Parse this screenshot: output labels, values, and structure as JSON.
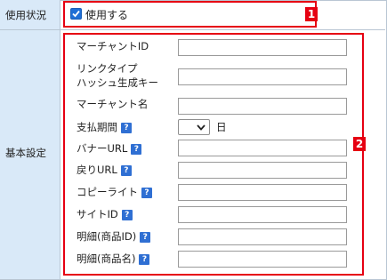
{
  "usage": {
    "label": "使用状況",
    "checkbox_label": "使用する",
    "checked": true,
    "badge": "1"
  },
  "basic": {
    "label": "基本設定",
    "badge": "2",
    "fields": {
      "merchant_id": "マーチャントID",
      "link_type_line1": "リンクタイプ",
      "link_type_line2": "ハッシュ生成キー",
      "merchant_name": "マーチャント名",
      "payment_period": "支払期間",
      "payment_period_unit": "日",
      "banner_url": "バナーURL",
      "return_url": "戻りURL",
      "copyright": "コピーライト",
      "site_id": "サイトID",
      "detail_product_id": "明細(商品ID)",
      "detail_product_name": "明細(商品名)"
    },
    "help_glyph": "?"
  },
  "colors": {
    "label_bg": "#d9e9f8",
    "highlight": "#e60012",
    "help_icon": "#2f6fd3",
    "checkbox": "#1f6fd6"
  }
}
